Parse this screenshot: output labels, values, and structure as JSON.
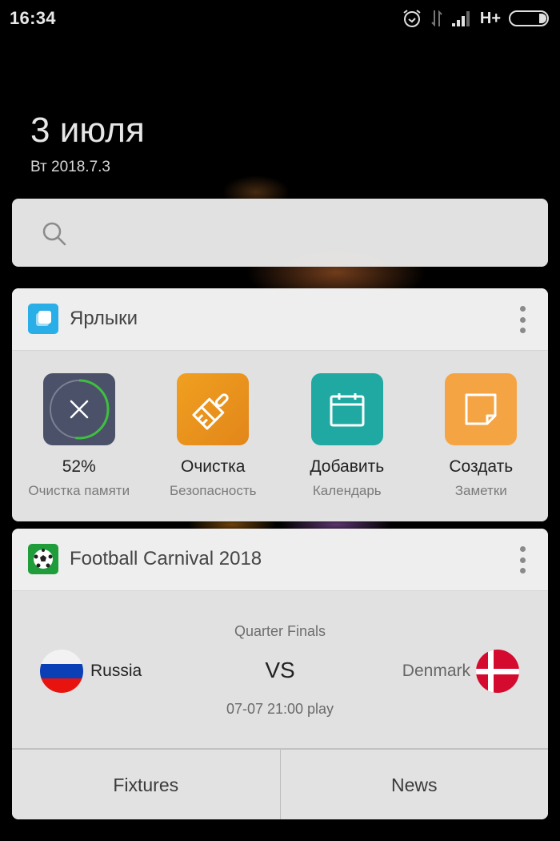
{
  "status_bar": {
    "time": "16:34",
    "icons": [
      "alarm-icon",
      "data-activity-icon",
      "signal-icon",
      "network-type",
      "battery-icon"
    ],
    "network_type": "H+"
  },
  "date": {
    "big": "3 июля",
    "small": "Вт 2018.7.3"
  },
  "search": {
    "placeholder": "",
    "value": ""
  },
  "shortcuts_widget": {
    "title": "Ярлыки",
    "items": [
      {
        "label": "52%",
        "sublabel": "Очистка памяти",
        "icon": "memory-clean-icon",
        "color": "#4a5168",
        "progress_percent": 52
      },
      {
        "label": "Очистка",
        "sublabel": "Безопасность",
        "icon": "broom-icon",
        "color": "#ee9520"
      },
      {
        "label": "Добавить",
        "sublabel": "Календарь",
        "icon": "calendar-icon",
        "color": "#1fa9a2"
      },
      {
        "label": "Создать",
        "sublabel": "Заметки",
        "icon": "note-icon",
        "color": "#f5a443"
      }
    ]
  },
  "football_widget": {
    "title": "Football Carnival 2018",
    "stage": "Quarter Finals",
    "home_team": "Russia",
    "away_team": "Denmark",
    "vs": "VS",
    "match_time": "07-07 21:00 play",
    "buttons": [
      "Fixtures",
      "News"
    ]
  },
  "colors": {
    "progress_ring": "#3fbf3f",
    "football_icon_bg": "#1f9d3a",
    "shortcuts_icon_bg": "#29aee8"
  }
}
